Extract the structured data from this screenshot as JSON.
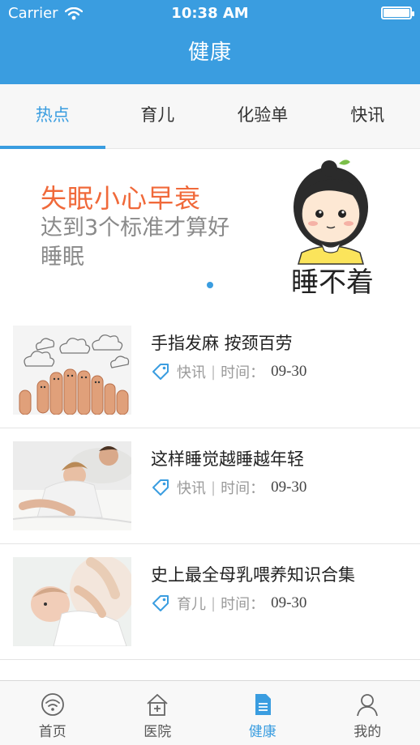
{
  "status_bar": {
    "carrier": "Carrier",
    "time": "10:38 AM",
    "battery_level": 1.0
  },
  "nav": {
    "title": "健康"
  },
  "tabs": [
    {
      "label": "热点",
      "active": true
    },
    {
      "label": "育儿",
      "active": false
    },
    {
      "label": "化验单",
      "active": false
    },
    {
      "label": "快讯",
      "active": false
    }
  ],
  "banner": {
    "title": "失眠小心早衰",
    "subtitle": "达到3个标准才算好睡眠",
    "art_caption": "睡不着",
    "page_dots": 1,
    "current_page": 1
  },
  "articles": [
    {
      "title": "手指发麻 按颈百劳",
      "category": "快讯",
      "time_label": "时间：",
      "date": "09-30",
      "thumb_icon": "fingers-clouds-image"
    },
    {
      "title": "这样睡觉越睡越年轻",
      "category": "快讯",
      "time_label": "时间：",
      "date": "09-30",
      "thumb_icon": "sleeping-couple-image"
    },
    {
      "title": "史上最全母乳喂养知识合集",
      "category": "育儿",
      "time_label": "时间：",
      "date": "09-30",
      "thumb_icon": "baby-feeding-image"
    }
  ],
  "tabbar": [
    {
      "label": "首页",
      "icon": "home-signal-icon",
      "active": false
    },
    {
      "label": "医院",
      "icon": "hospital-icon",
      "active": false
    },
    {
      "label": "健康",
      "icon": "document-icon",
      "active": true
    },
    {
      "label": "我的",
      "icon": "user-icon",
      "active": false
    }
  ],
  "colors": {
    "accent": "#3a9de0",
    "banner_title": "#f0693a"
  }
}
